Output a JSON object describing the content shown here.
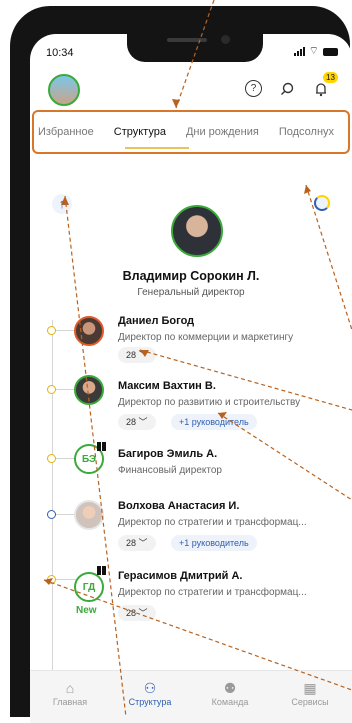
{
  "status": {
    "time": "10:34"
  },
  "header": {
    "notifications_count": "13"
  },
  "tabs": [
    "Избранное",
    "Структура",
    "Дни рождения",
    "Подсолнух"
  ],
  "active_tab": "Структура",
  "manager": {
    "name": "Владимир Сорокин Л.",
    "role": "Генеральный директор"
  },
  "employees": [
    {
      "name": "Даниел Богод",
      "role": "Директор по коммерции и маркетингу",
      "count": "28 ﹀",
      "extra": ""
    },
    {
      "name": "Максим Вахтин В.",
      "role": "Директор по развитию и строительству",
      "count": "28 ﹀",
      "extra": "+1 руководитель"
    },
    {
      "name": "Багиров Эмиль А.",
      "role": "Финансовый директор",
      "initials": "БЭ"
    },
    {
      "name": "Волхова Анастасия И.",
      "role": "Директор по стратегии и трансформац...",
      "count": "28 ﹀",
      "extra": "+1 руководитель"
    },
    {
      "name": "Герасимов Дмитрий А.",
      "role": "Директор по стратегии и трансформац...",
      "count": "28 ﹀",
      "initials": "ГД",
      "new_label": "New"
    }
  ],
  "bottom_nav": [
    {
      "label": "Главная",
      "icon": "home-icon"
    },
    {
      "label": "Структура",
      "icon": "structure-icon"
    },
    {
      "label": "Команда",
      "icon": "team-icon"
    },
    {
      "label": "Сервисы",
      "icon": "services-icon"
    }
  ],
  "colors": {
    "accent_blue": "#2f5fb0",
    "accent_green": "#3aaa3a",
    "accent_yellow": "#ffd400",
    "annotation_orange": "#d8762a"
  },
  "icons": [
    "help-icon",
    "search-icon",
    "bell-icon",
    "up-arrow-icon",
    "loading-icon",
    "gift-icon"
  ]
}
